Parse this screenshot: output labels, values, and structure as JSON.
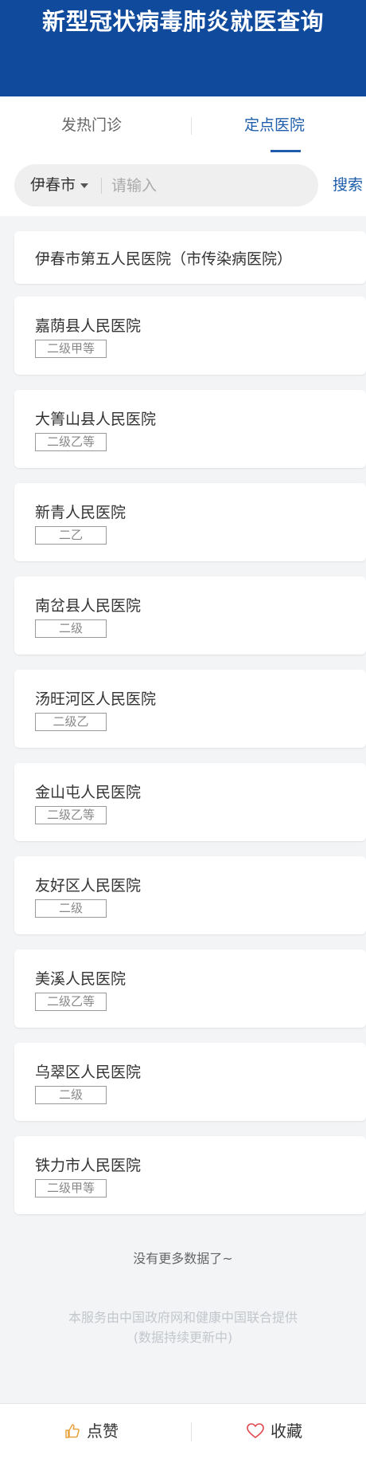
{
  "header": {
    "title": "新型冠状病毒肺炎就医查询"
  },
  "tabs": [
    {
      "label": "发热门诊",
      "active": false
    },
    {
      "label": "定点医院",
      "active": true
    }
  ],
  "search": {
    "city": "伊春市",
    "placeholder": "请输入",
    "value": "",
    "button_label": "搜索"
  },
  "hospitals": [
    {
      "name": "伊春市第五人民医院（市传染病医院）",
      "grade": ""
    },
    {
      "name": "嘉荫县人民医院",
      "grade": "二级甲等"
    },
    {
      "name": "大箐山县人民医院",
      "grade": "二级乙等"
    },
    {
      "name": "新青人民医院",
      "grade": "二乙"
    },
    {
      "name": "南岔县人民医院",
      "grade": "二级"
    },
    {
      "name": "汤旺河区人民医院",
      "grade": "二级乙"
    },
    {
      "name": "金山屯人民医院",
      "grade": "二级乙等"
    },
    {
      "name": "友好区人民医院",
      "grade": "二级"
    },
    {
      "name": "美溪人民医院",
      "grade": "二级乙等"
    },
    {
      "name": "乌翠区人民医院",
      "grade": "二级"
    },
    {
      "name": "铁力市人民医院",
      "grade": "二级甲等"
    }
  ],
  "footer": {
    "no_more": "没有更多数据了~",
    "provider_line1": "本服务由中国政府网和健康中国联合提供",
    "provider_line2": "(数据持续更新中)"
  },
  "bottom_bar": {
    "like_label": "点赞",
    "favorite_label": "收藏"
  },
  "colors": {
    "header_bg": "#0f4a9c",
    "accent": "#1d5dab",
    "page_bg": "#f3f4f6"
  },
  "icons": {
    "like": "thumbs-up-icon",
    "favorite": "heart-icon",
    "dropdown": "caret-down-icon"
  }
}
